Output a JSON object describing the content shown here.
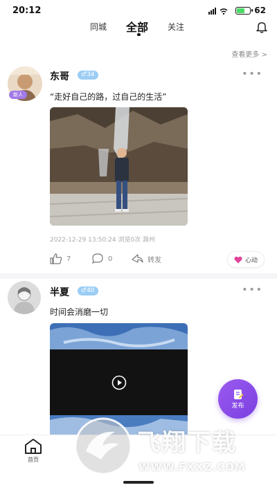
{
  "status_bar": {
    "time": "20:12",
    "battery": "62",
    "signal_text": "ᯤ ᯤ"
  },
  "top_tabs": {
    "tabs": [
      "同城",
      "全部",
      "关注"
    ],
    "active": "全部"
  },
  "see_more": "查看更多",
  "posts": [
    {
      "name": "东哥",
      "age": "♂34",
      "avatar_badge": "新人",
      "text": "“走好自己的路，过自己的生活”",
      "meta": "2022-12-29 13:50:24  浏览0次  滁州",
      "likes": "7",
      "comments": "0",
      "share_label": "转发",
      "heart_label": "心动"
    },
    {
      "name": "半夏",
      "age": "♂40",
      "text": "时间会消磨一切"
    }
  ],
  "fab_label": "发布",
  "bottom_nav": {
    "home_label": "首页"
  },
  "watermark": {
    "title": "飞翔下载",
    "url": "WWW.FXXZ.COM"
  },
  "colors": {
    "accent": "#8a4fe6",
    "age_badge": "#9bcdf5",
    "heart": "#e0439a"
  }
}
